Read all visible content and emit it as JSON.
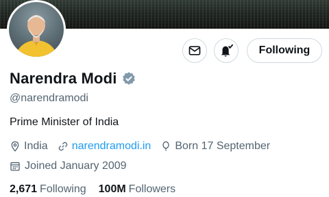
{
  "profile": {
    "name": "Narendra Modi",
    "handle": "@narendramodi",
    "bio": "Prime Minister of India",
    "location": "India",
    "website": "narendramodi.in",
    "birthday": "Born 17 September",
    "joined": "Joined January 2009",
    "verified": true
  },
  "actions": {
    "follow_label": "Following",
    "message_icon": "mail-icon",
    "notify_icon": "bell-icon"
  },
  "stats": {
    "following_count": "2,671",
    "following_label": "Following",
    "followers_count": "100M",
    "followers_label": "Followers"
  },
  "colors": {
    "link": "#1d9bf0",
    "muted": "#536471",
    "verified_badge": "#829aab"
  }
}
